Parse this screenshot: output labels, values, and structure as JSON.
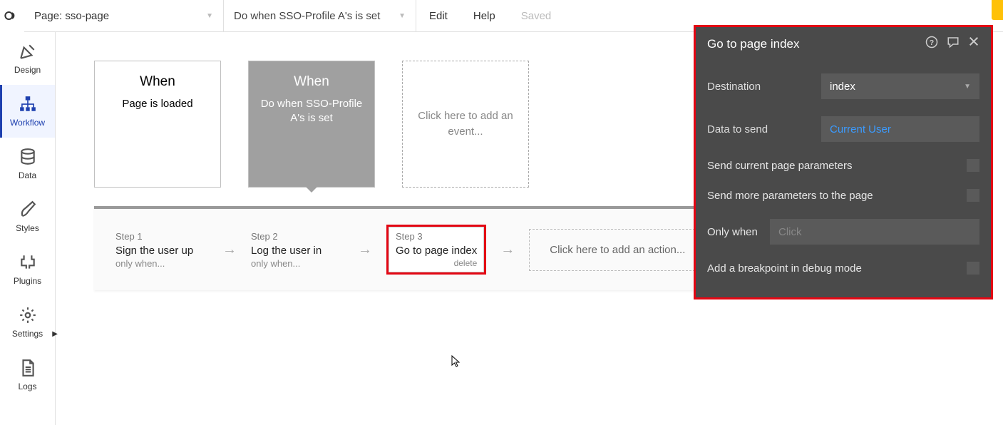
{
  "topbar": {
    "page_prefix": "Page: ",
    "page_name": "sso-page",
    "expression": "Do when SSO-Profile A's is set",
    "edit": "Edit",
    "help": "Help",
    "saved": "Saved"
  },
  "sidebar": {
    "items": [
      {
        "label": "Design"
      },
      {
        "label": "Workflow"
      },
      {
        "label": "Data"
      },
      {
        "label": "Styles"
      },
      {
        "label": "Plugins"
      },
      {
        "label": "Settings"
      },
      {
        "label": "Logs"
      }
    ]
  },
  "events": [
    {
      "when": "When",
      "desc": "Page is loaded"
    },
    {
      "when": "When",
      "desc": "Do when SSO-Profile A's is set"
    },
    {
      "add": "Click here to add an event..."
    }
  ],
  "steps": [
    {
      "num": "Step 1",
      "title": "Sign the user up",
      "cond": "only when..."
    },
    {
      "num": "Step 2",
      "title": "Log the user in",
      "cond": "only when..."
    },
    {
      "num": "Step 3",
      "title": "Go to page index",
      "del": "delete"
    }
  ],
  "add_action": "Click here to add an action...",
  "panel": {
    "title": "Go to page index",
    "destination_label": "Destination",
    "destination_value": "index",
    "data_label": "Data to send",
    "data_value": "Current User",
    "send_current": "Send current page parameters",
    "send_more": "Send more parameters to the page",
    "only_when": "Only when",
    "click_placeholder": "Click",
    "breakpoint": "Add a breakpoint in debug mode"
  }
}
